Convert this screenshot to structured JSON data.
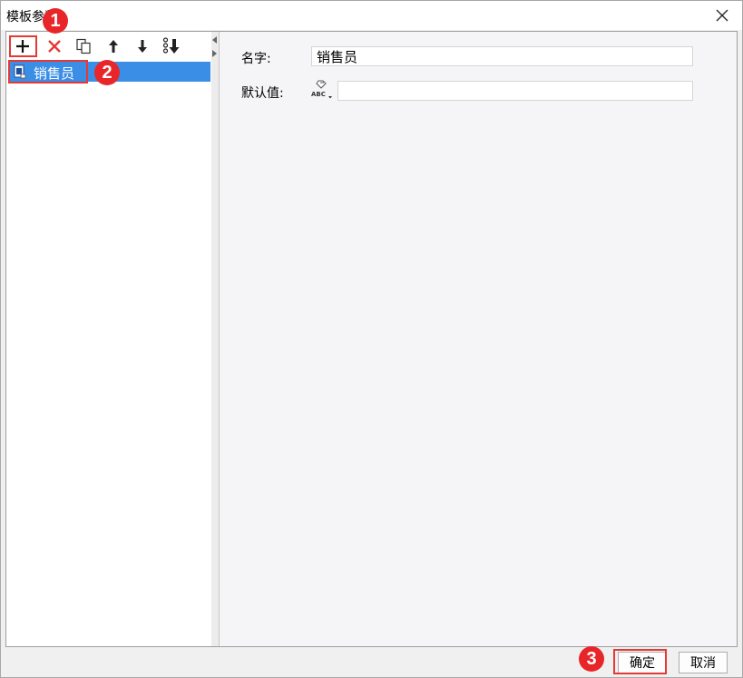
{
  "window": {
    "title": "模板参数"
  },
  "toolbar": {
    "icons": [
      "add-icon",
      "delete-icon",
      "copy-icon",
      "move-up-icon",
      "move-down-icon",
      "sort-icon"
    ]
  },
  "tree": {
    "items": [
      {
        "label": "销售员",
        "selected": true
      }
    ]
  },
  "form": {
    "name_label": "名字:",
    "name_value": "销售员",
    "default_label": "默认值:",
    "default_value": "",
    "type_icon": "ABC"
  },
  "footer": {
    "ok_label": "确定",
    "cancel_label": "取消"
  },
  "callouts": [
    "1",
    "2",
    "3"
  ],
  "colors": {
    "selection": "#3a8ee6",
    "callout": "#e8262a",
    "highlight_box": "#e53935"
  }
}
